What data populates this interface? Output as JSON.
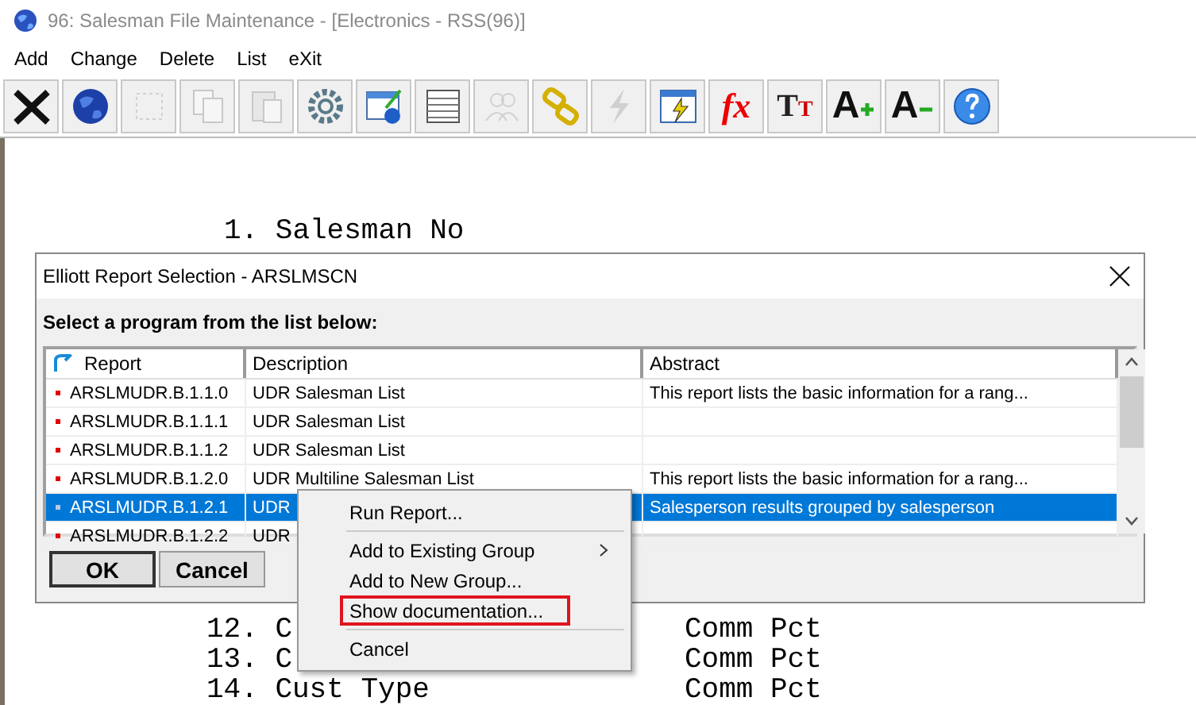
{
  "window": {
    "title": "96: Salesman File Maintenance - [Electronics - RSS(96)]"
  },
  "menu": [
    "Add",
    "Change",
    "Delete",
    "List",
    "eXit"
  ],
  "toolbar": [
    {
      "kind": "close",
      "disabled": false
    },
    {
      "kind": "globe",
      "disabled": false
    },
    {
      "kind": "select",
      "disabled": true
    },
    {
      "kind": "copy",
      "disabled": true
    },
    {
      "kind": "paste",
      "disabled": true
    },
    {
      "kind": "gear",
      "disabled": false
    },
    {
      "kind": "info",
      "disabled": false
    },
    {
      "kind": "table",
      "disabled": false
    },
    {
      "kind": "users",
      "disabled": true
    },
    {
      "kind": "link",
      "disabled": false
    },
    {
      "kind": "lightning",
      "disabled": true
    },
    {
      "kind": "report",
      "disabled": false
    },
    {
      "kind": "formula",
      "glyph": "fx",
      "disabled": false
    },
    {
      "kind": "fonts",
      "glyph": "TT",
      "disabled": false
    },
    {
      "kind": "grow",
      "glyph": "A",
      "disabled": false
    },
    {
      "kind": "shrink",
      "glyph": "A",
      "disabled": false
    },
    {
      "kind": "help",
      "disabled": false
    }
  ],
  "form": {
    "top_lines": [
      {
        "left": "1. Salesman No"
      }
    ],
    "bottom_lines": [
      {
        "left": "12. C",
        "right": "Comm Pct"
      },
      {
        "left": "13. C",
        "right": "Comm Pct"
      },
      {
        "left": "14. Cust Type",
        "right": "Comm Pct"
      }
    ]
  },
  "dialog": {
    "title": "Elliott Report Selection - ARSLMSCN",
    "prompt": "Select a program from the list below:",
    "columns": [
      "Report",
      "Description",
      "Abstract"
    ],
    "rows": [
      {
        "report": "ARSLMUDR.B.1.1.0",
        "description": "UDR Salesman List",
        "abstract": "This report lists the basic information for a rang...",
        "selected": false
      },
      {
        "report": "ARSLMUDR.B.1.1.1",
        "description": "UDR Salesman List",
        "selected": false
      },
      {
        "report": "ARSLMUDR.B.1.1.2",
        "description": "UDR Salesman List",
        "selected": false
      },
      {
        "report": "ARSLMUDR.B.1.2.0",
        "description": "UDR Multiline Salesman List",
        "abstract": "This report lists the basic information for a rang...",
        "selected": false
      },
      {
        "report": "ARSLMUDR.B.1.2.1",
        "description": "UDR",
        "abstract": "Salesperson results grouped by salesperson",
        "selected": true
      },
      {
        "report": "ARSLMUDR.B.1.2.2",
        "description": "UDR",
        "selected": false
      }
    ],
    "buttons": [
      {
        "label": "OK",
        "default": true
      },
      {
        "label": "Cancel",
        "default": false
      }
    ]
  },
  "context_menu": [
    {
      "kind": "item",
      "label": "Run Report...",
      "submenu": false,
      "outlined": false
    },
    {
      "kind": "separator"
    },
    {
      "kind": "item",
      "label": "Add to Existing Group",
      "submenu": true,
      "outlined": false
    },
    {
      "kind": "item",
      "label": "Add to New Group...",
      "submenu": false,
      "outlined": false
    },
    {
      "kind": "item",
      "label": "Show documentation...",
      "submenu": false,
      "outlined": true
    },
    {
      "kind": "separator"
    },
    {
      "kind": "item",
      "label": "Cancel",
      "submenu": false,
      "outlined": false
    }
  ]
}
